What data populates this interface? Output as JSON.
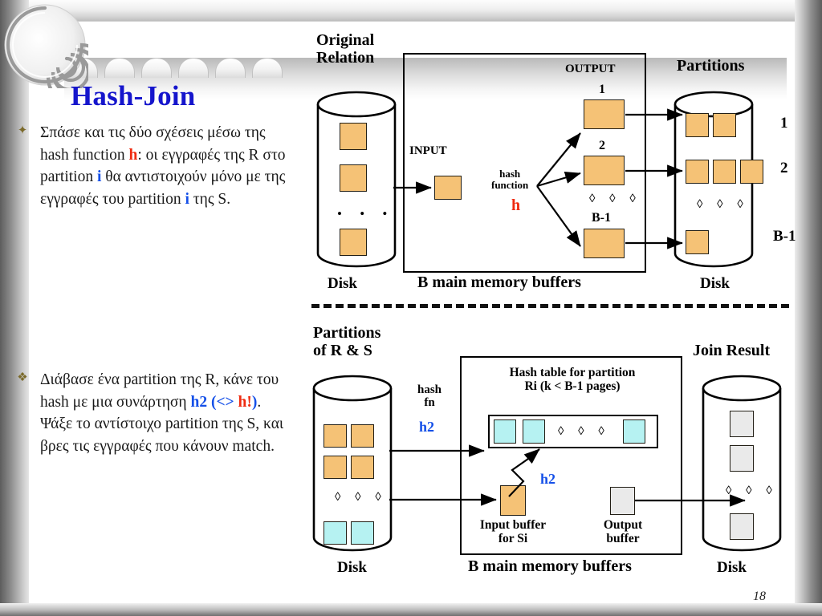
{
  "slide": {
    "title": "Hash-Join",
    "page_number": "18",
    "title_color": "#1515CC",
    "accent_orange": "#F5C276",
    "accent_cyan": "#B6F2F2",
    "accent_gray": "#EAEAEA",
    "highlight_red": "#EF2B10",
    "highlight_blue": "#1550E8"
  },
  "bullets": [
    {
      "marker": "✦",
      "segments": [
        {
          "text": "Σπάσε και τις δύο σχέσεις μέσω της  hash function ",
          "style": "normal"
        },
        {
          "text": "h",
          "style": "red"
        },
        {
          "text": ": οι εγγραφές της R στο partition ",
          "style": "normal"
        },
        {
          "text": "i",
          "style": "blue"
        },
        {
          "text": " θα αντιστοιχούν μόνο με της εγγραφές του partition ",
          "style": "normal"
        },
        {
          "text": "i",
          "style": "blue"
        },
        {
          "text": " της S.",
          "style": "normal"
        }
      ]
    },
    {
      "marker": "❖",
      "segments": [
        {
          "text": "Διάβασε ένα partition της R, κάνε του hash με μια συνάρτηση ",
          "style": "normal"
        },
        {
          "text": "h2 (<> ",
          "style": "blue"
        },
        {
          "text": "h!",
          "style": "red"
        },
        {
          "text": ")",
          "style": "blue"
        },
        {
          "text": ". Ψάξε το αντίστοιχο partition της S, και βρες τις εγγραφές που κάνουν match.",
          "style": "normal"
        }
      ]
    }
  ],
  "diagram_top": {
    "heading_original_relation": "Original\nRelation",
    "heading_original_relation_line1": "Original",
    "heading_original_relation_line2": "Relation",
    "heading_partitions": "Partitions",
    "label_output": "OUTPUT",
    "label_input": "INPUT",
    "label_hash_function_line1": "hash",
    "label_hash_function_line2": "function",
    "label_h": "h",
    "label_disk_left": "Disk",
    "label_disk_right": "Disk",
    "label_buffers": "B main memory buffers",
    "output_buffer_labels": [
      "1",
      "2",
      "B-1"
    ],
    "partition_labels": [
      "1",
      "2",
      "B-1"
    ],
    "partition_page_counts": [
      2,
      3,
      1
    ],
    "source_pages": 3,
    "ellipsis": "• • •",
    "ellipsis_diamond": "◊ ◊ ◊"
  },
  "diagram_bottom": {
    "heading_partitions_line1": "Partitions",
    "heading_partitions_line2": "of R & S",
    "heading_join_result": "Join Result",
    "label_hash_fn_line1": "hash",
    "label_hash_fn_line2": "fn",
    "label_h2": "h2",
    "label_h2_inner": "h2",
    "label_hash_table_line1": "Hash table for partition",
    "label_hash_table_line2": "Ri (k < B-1 pages)",
    "label_input_buffer_line1": "Input buffer",
    "label_input_buffer_line2": "for Si",
    "label_output_buffer_line1": "Output",
    "label_output_buffer_line2": "buffer",
    "label_disk_left": "Disk",
    "label_disk_right": "Disk",
    "label_buffers": "B main memory buffers",
    "hash_table_slots": 3,
    "join_result_pages": 3,
    "ellipsis_diamond": "◊ ◊ ◊"
  }
}
